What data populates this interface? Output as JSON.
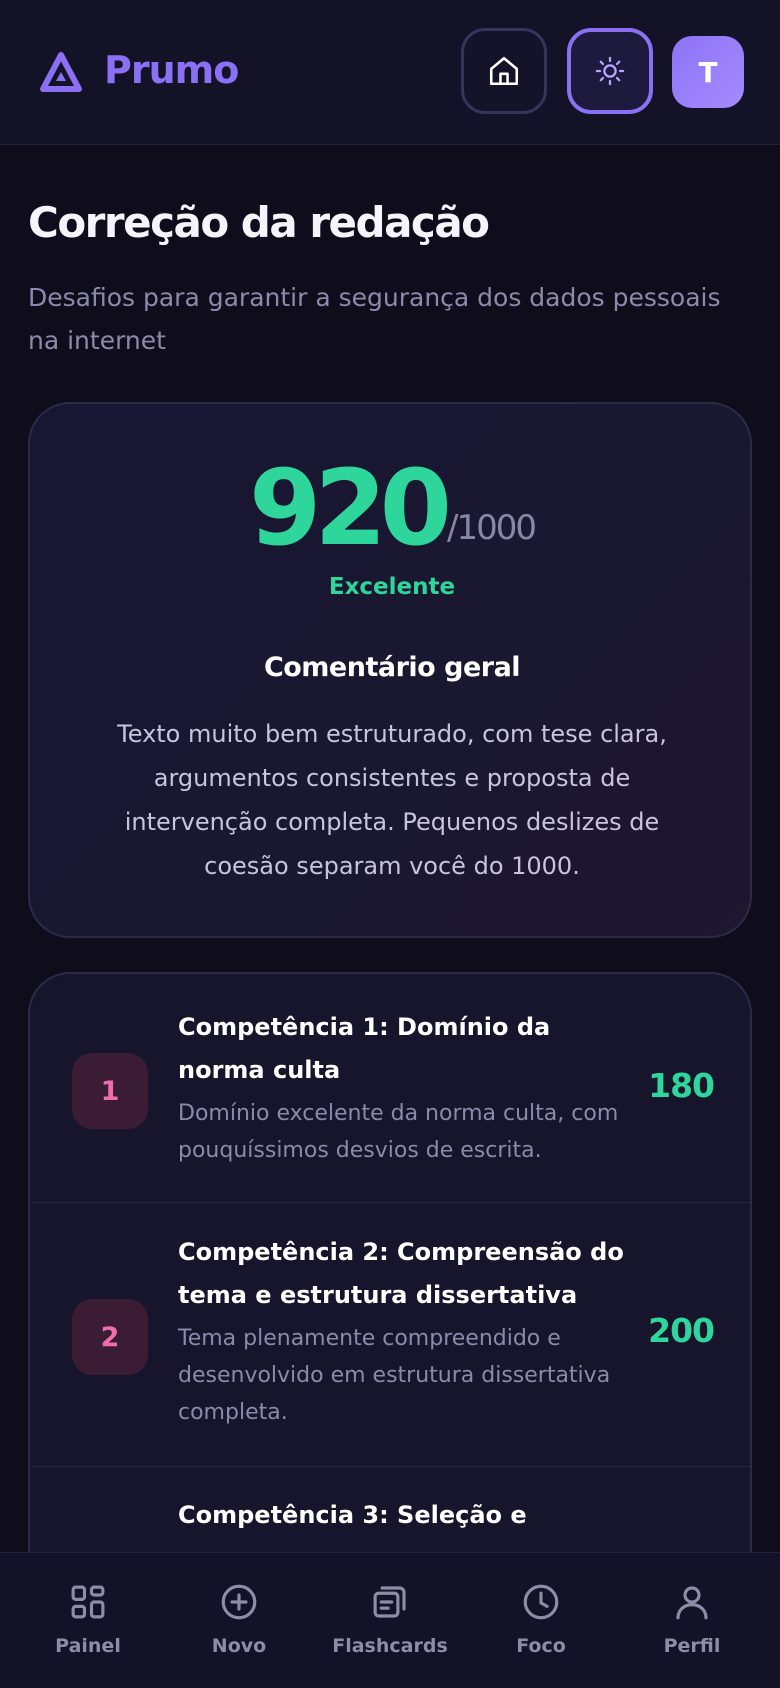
{
  "app": {
    "name": "Prumo",
    "avatar_initial": "T"
  },
  "header": {
    "icons": [
      "triangle-logo-icon",
      "home-icon",
      "sun-icon"
    ]
  },
  "page": {
    "title": "Correção da redação",
    "subtitle": "Desafios para garantir a segurança dos dados pessoais na internet"
  },
  "score": {
    "value": "920",
    "max": "/1000",
    "label": "Excelente",
    "comment_title": "Comentário geral",
    "comment": "Texto muito bem estruturado, com tese clara, argumentos consistentes e proposta de intervenção completa. Pequenos deslizes de coesão separam você do 1000."
  },
  "competencies": [
    {
      "number": "1",
      "title": "Competência 1: Domínio da norma culta",
      "description": "Domínio excelente da norma culta, com pouquíssimos desvios de escrita.",
      "score": "180"
    },
    {
      "number": "2",
      "title": "Competência 2: Compreensão do tema e estrutura dissertativa",
      "description": "Tema plenamente compreendido e desenvolvido em estrutura dissertativa completa.",
      "score": "200"
    },
    {
      "number": "3",
      "title": "Competência 3: Seleção e",
      "description": "",
      "score": ""
    }
  ],
  "nav": [
    {
      "label": "Painel",
      "icon": "grid-icon"
    },
    {
      "label": "Novo",
      "icon": "plus-circle-icon"
    },
    {
      "label": "Flashcards",
      "icon": "flashcards-icon"
    },
    {
      "label": "Foco",
      "icon": "clock-icon"
    },
    {
      "label": "Perfil",
      "icon": "user-icon"
    }
  ],
  "colors": {
    "accent": "#8b6ff5",
    "score_green": "#2ed69c",
    "badge_pink": "#f06eb0",
    "background": "#0f0d1c"
  }
}
